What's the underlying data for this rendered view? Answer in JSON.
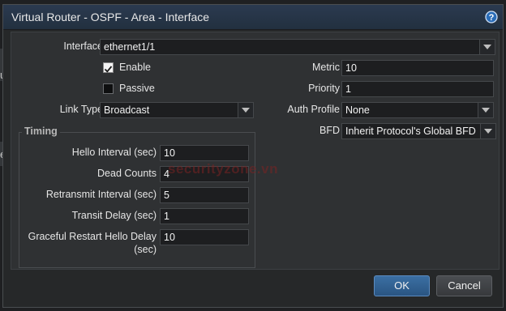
{
  "dialog": {
    "title": "Virtual Router - OSPF - Area - Interface",
    "help_icon": "help-circle-icon"
  },
  "background": {
    "chars": [
      "u",
      "e"
    ]
  },
  "form": {
    "interface": {
      "label": "Interface",
      "value": "ethernet1/1"
    },
    "enable": {
      "label": "Enable",
      "checked": true
    },
    "passive": {
      "label": "Passive",
      "checked": false
    },
    "link_type": {
      "label": "Link Type",
      "value": "Broadcast"
    },
    "metric": {
      "label": "Metric",
      "value": "10"
    },
    "priority": {
      "label": "Priority",
      "value": "1"
    },
    "auth_profile": {
      "label": "Auth Profile",
      "value": "None"
    },
    "bfd": {
      "label": "BFD",
      "value": "Inherit Protocol's Global BFD"
    }
  },
  "timing": {
    "legend": "Timing",
    "hello_interval": {
      "label": "Hello Interval (sec)",
      "value": "10"
    },
    "dead_counts": {
      "label": "Dead Counts",
      "value": "4"
    },
    "retransmit_interval": {
      "label": "Retransmit Interval (sec)",
      "value": "5"
    },
    "transit_delay": {
      "label": "Transit Delay (sec)",
      "value": "1"
    },
    "graceful_restart": {
      "label_line1": "Graceful Restart Hello Delay",
      "label_line2": "(sec)",
      "value": "10"
    }
  },
  "buttons": {
    "ok": "OK",
    "cancel": "Cancel"
  },
  "watermark": "securityzone.vn",
  "colors": {
    "accent": "#3b6fa3",
    "titlebar": "#2b3a50",
    "panel": "#2f3133",
    "input_bg": "#1d1e20"
  }
}
